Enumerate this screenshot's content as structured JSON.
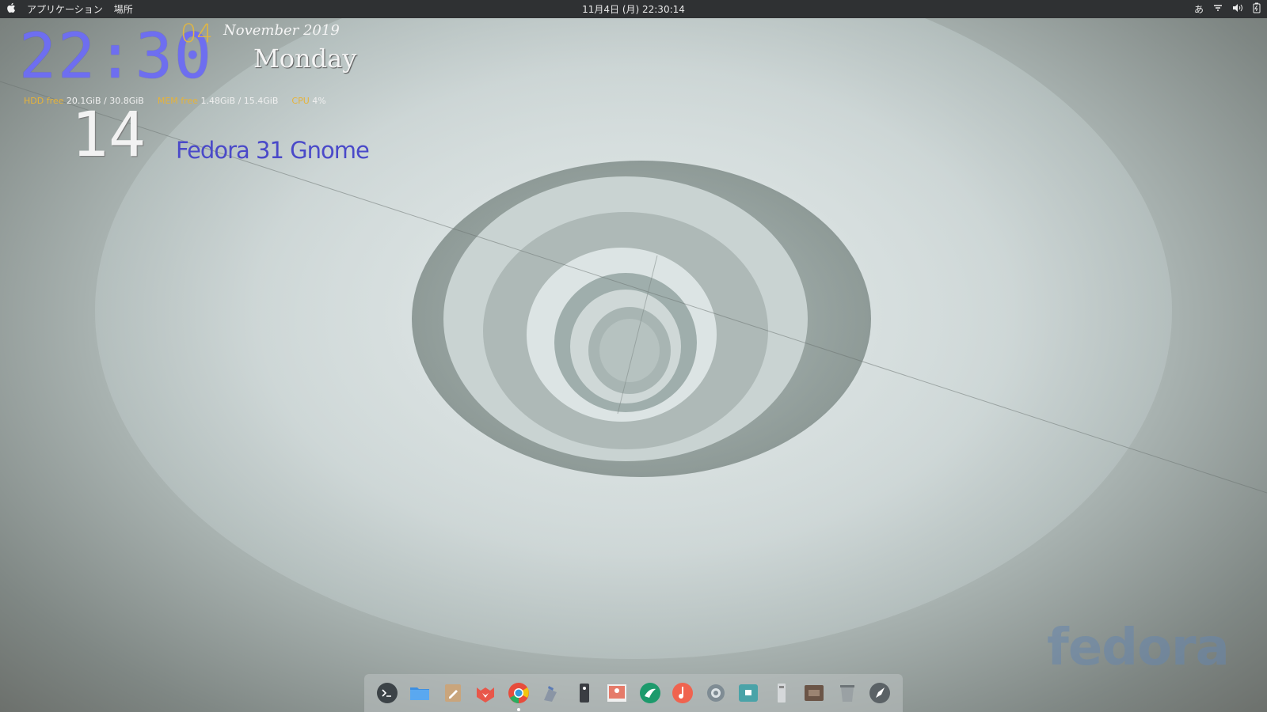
{
  "topbar": {
    "apple_menu_icon": "apple-icon",
    "applications_label": "アプリケーション",
    "places_label": "場所",
    "datetime": "11月4日 (月)  22:30:14",
    "input_method": "あ",
    "status_icons": [
      "network-icon",
      "volume-icon",
      "battery-icon"
    ]
  },
  "conky": {
    "time": "22:30",
    "day": "04",
    "month_year": "November 2019",
    "weekday": "Monday",
    "hdd_label": "HDD free",
    "hdd_value": "20.1GiB / 30.8GiB",
    "mem_label": "MEM free",
    "mem_value": "1.48GiB / 15.4GiB",
    "cpu_label": "CPU",
    "cpu_value": "4%",
    "seconds": "14",
    "os_label": "Fedora 31 Gnome"
  },
  "wallpaper": {
    "logo_text": "fedora"
  },
  "dock": {
    "items": [
      {
        "name": "terminal-icon",
        "running": false
      },
      {
        "name": "files-icon",
        "running": false
      },
      {
        "name": "text-editor-icon",
        "running": false
      },
      {
        "name": "firefox-icon",
        "running": false
      },
      {
        "name": "chrome-icon",
        "running": true
      },
      {
        "name": "tweaks-icon",
        "running": false
      },
      {
        "name": "system-monitor-icon",
        "running": false
      },
      {
        "name": "image-viewer-icon",
        "running": false
      },
      {
        "name": "inkscape-icon",
        "running": false
      },
      {
        "name": "music-icon",
        "running": false
      },
      {
        "name": "settings-icon",
        "running": false
      },
      {
        "name": "screenshot-icon",
        "running": false
      },
      {
        "name": "usb-drive-icon",
        "running": false
      },
      {
        "name": "hdd-icon",
        "running": false
      },
      {
        "name": "trash-icon",
        "running": false
      },
      {
        "name": "launcher-icon",
        "running": false
      }
    ]
  },
  "colors": {
    "clock": "#6e6ef0",
    "day": "#e0b642",
    "label_accent": "#e6b33a",
    "os_label": "#4a49c9",
    "topbar": "#2f3133"
  }
}
